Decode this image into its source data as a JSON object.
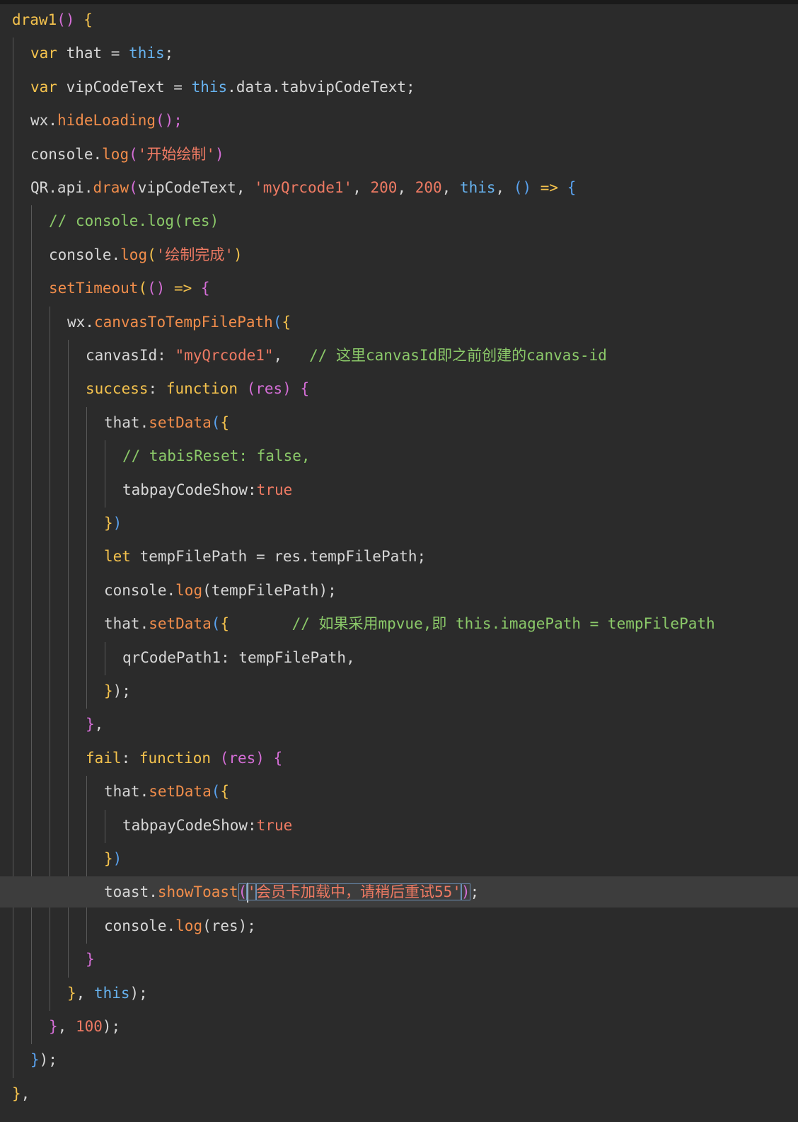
{
  "editor": {
    "colors": {
      "background": "#2b2b2b",
      "active_line": "#3d3d3d",
      "keyword": "#f4c24d",
      "string": "#ee7a63",
      "comment": "#8bc969",
      "builtin": "#67b3f0",
      "function": "#f18d4b"
    },
    "lines": [
      {
        "indent": 0,
        "tokens": [
          [
            "draw1",
            "keyword"
          ],
          [
            "()",
            "brace2"
          ],
          [
            " ",
            "default"
          ],
          [
            "{",
            "brace1"
          ]
        ]
      },
      {
        "indent": 1,
        "tokens": [
          [
            "var",
            "keyword"
          ],
          [
            " that = ",
            "default"
          ],
          [
            "this",
            "builtin"
          ],
          [
            ";",
            "default"
          ]
        ]
      },
      {
        "indent": 1,
        "tokens": [
          [
            "var",
            "keyword"
          ],
          [
            " vipCodeText = ",
            "default"
          ],
          [
            "this",
            "builtin"
          ],
          [
            ".data.tabvipCodeText;",
            "default"
          ]
        ]
      },
      {
        "indent": 1,
        "tokens": [
          [
            "wx.",
            "default"
          ],
          [
            "hideLoading",
            "func"
          ],
          [
            "();",
            "brace2"
          ]
        ]
      },
      {
        "indent": 1,
        "tokens": [
          [
            "console.",
            "default"
          ],
          [
            "log",
            "func"
          ],
          [
            "(",
            "brace2"
          ],
          [
            "'开始绘制'",
            "string"
          ],
          [
            ")",
            "brace2"
          ]
        ]
      },
      {
        "indent": 1,
        "tokens": [
          [
            "QR.api.",
            "default"
          ],
          [
            "draw",
            "func"
          ],
          [
            "(",
            "brace2"
          ],
          [
            "vipCodeText, ",
            "default"
          ],
          [
            "'myQrcode1'",
            "string"
          ],
          [
            ", ",
            "default"
          ],
          [
            "200",
            "number"
          ],
          [
            ", ",
            "default"
          ],
          [
            "200",
            "number"
          ],
          [
            ", ",
            "default"
          ],
          [
            "this",
            "builtin"
          ],
          [
            ", ",
            "default"
          ],
          [
            "()",
            "brace3"
          ],
          [
            " => ",
            "keyword"
          ],
          [
            "{",
            "brace3"
          ]
        ]
      },
      {
        "indent": 2,
        "tokens": [
          [
            "// console.log(res)",
            "comment"
          ]
        ]
      },
      {
        "indent": 2,
        "tokens": [
          [
            "console.",
            "default"
          ],
          [
            "log",
            "func"
          ],
          [
            "(",
            "brace1"
          ],
          [
            "'绘制完成'",
            "string"
          ],
          [
            ")",
            "brace1"
          ]
        ]
      },
      {
        "indent": 2,
        "tokens": [
          [
            "setTimeout",
            "func"
          ],
          [
            "(",
            "brace1"
          ],
          [
            "()",
            "brace2"
          ],
          [
            " => ",
            "keyword"
          ],
          [
            "{",
            "brace2"
          ]
        ]
      },
      {
        "indent": 3,
        "tokens": [
          [
            "wx.",
            "default"
          ],
          [
            "canvasToTempFilePath",
            "func"
          ],
          [
            "(",
            "brace3"
          ],
          [
            "{",
            "brace1"
          ]
        ]
      },
      {
        "indent": 4,
        "tokens": [
          [
            "canvasId: ",
            "default"
          ],
          [
            "\"myQrcode1\"",
            "string"
          ],
          [
            ",   ",
            "default"
          ],
          [
            "// 这里canvasId即之前创建的canvas-id",
            "comment"
          ]
        ]
      },
      {
        "indent": 4,
        "tokens": [
          [
            "success",
            "keyword"
          ],
          [
            ": ",
            "default"
          ],
          [
            "function",
            "keyword"
          ],
          [
            " ",
            "default"
          ],
          [
            "(res)",
            "brace2"
          ],
          [
            " ",
            "default"
          ],
          [
            "{",
            "brace2"
          ]
        ]
      },
      {
        "indent": 5,
        "tokens": [
          [
            "that.",
            "default"
          ],
          [
            "setData",
            "func"
          ],
          [
            "(",
            "brace3"
          ],
          [
            "{",
            "brace1"
          ]
        ]
      },
      {
        "indent": 6,
        "tokens": [
          [
            "// tabisReset: false,",
            "comment"
          ]
        ]
      },
      {
        "indent": 6,
        "tokens": [
          [
            "tabpayCodeShow:",
            "default"
          ],
          [
            "true",
            "string"
          ]
        ]
      },
      {
        "indent": 5,
        "tokens": [
          [
            "}",
            "brace1"
          ],
          [
            ")",
            "brace3"
          ]
        ]
      },
      {
        "indent": 5,
        "tokens": [
          [
            "let",
            "keyword"
          ],
          [
            " tempFilePath = res.tempFilePath;",
            "default"
          ]
        ]
      },
      {
        "indent": 5,
        "tokens": [
          [
            "console.",
            "default"
          ],
          [
            "log",
            "func"
          ],
          [
            "(tempFilePath);",
            "default"
          ]
        ]
      },
      {
        "indent": 5,
        "tokens": [
          [
            "that.",
            "default"
          ],
          [
            "setData",
            "func"
          ],
          [
            "(",
            "brace3"
          ],
          [
            "{",
            "brace1"
          ],
          [
            "       ",
            "default"
          ],
          [
            "// 如果采用mpvue,即 this.imagePath = tempFilePath",
            "comment"
          ]
        ]
      },
      {
        "indent": 6,
        "tokens": [
          [
            "qrCodePath1: tempFilePath,",
            "default"
          ]
        ]
      },
      {
        "indent": 5,
        "tokens": [
          [
            "}",
            "brace1"
          ],
          [
            ");",
            "default"
          ]
        ]
      },
      {
        "indent": 4,
        "tokens": [
          [
            "}",
            "brace2"
          ],
          [
            ",",
            "default"
          ]
        ]
      },
      {
        "indent": 4,
        "tokens": [
          [
            "fail",
            "keyword"
          ],
          [
            ": ",
            "default"
          ],
          [
            "function",
            "keyword"
          ],
          [
            " ",
            "default"
          ],
          [
            "(res)",
            "brace2"
          ],
          [
            " ",
            "default"
          ],
          [
            "{",
            "brace2"
          ]
        ]
      },
      {
        "indent": 5,
        "tokens": [
          [
            "that.",
            "default"
          ],
          [
            "setData",
            "func"
          ],
          [
            "(",
            "brace3"
          ],
          [
            "{",
            "brace1"
          ]
        ]
      },
      {
        "indent": 6,
        "tokens": [
          [
            "tabpayCodeShow:",
            "default"
          ],
          [
            "true",
            "string"
          ]
        ]
      },
      {
        "indent": 5,
        "tokens": [
          [
            "}",
            "brace1"
          ],
          [
            ")",
            "brace3"
          ]
        ]
      },
      {
        "indent": 5,
        "active": true,
        "tokens": [
          [
            "toast.",
            "default"
          ],
          [
            "showToast",
            "func"
          ],
          [
            "(",
            "hl"
          ],
          [
            "'",
            "caret"
          ],
          [
            "会员卡加载中，请稍后重试55'",
            "hlstring"
          ],
          [
            ")",
            "hl"
          ],
          [
            ";",
            "default"
          ]
        ]
      },
      {
        "indent": 5,
        "tokens": [
          [
            "console.",
            "default"
          ],
          [
            "log",
            "func"
          ],
          [
            "(res);",
            "default"
          ]
        ]
      },
      {
        "indent": 4,
        "tokens": [
          [
            "}",
            "brace2"
          ]
        ]
      },
      {
        "indent": 3,
        "tokens": [
          [
            "}",
            "brace1"
          ],
          [
            ", ",
            "default"
          ],
          [
            "this",
            "builtin"
          ],
          [
            ");",
            "default"
          ]
        ]
      },
      {
        "indent": 2,
        "tokens": [
          [
            "}",
            "brace2"
          ],
          [
            ", ",
            "default"
          ],
          [
            "100",
            "number"
          ],
          [
            ");",
            "default"
          ]
        ]
      },
      {
        "indent": 1,
        "tokens": [
          [
            "}",
            "brace3"
          ],
          [
            ");",
            "default"
          ]
        ]
      },
      {
        "indent": 0,
        "tokens": [
          [
            "}",
            "brace1"
          ],
          [
            ",",
            "default"
          ]
        ]
      }
    ]
  }
}
